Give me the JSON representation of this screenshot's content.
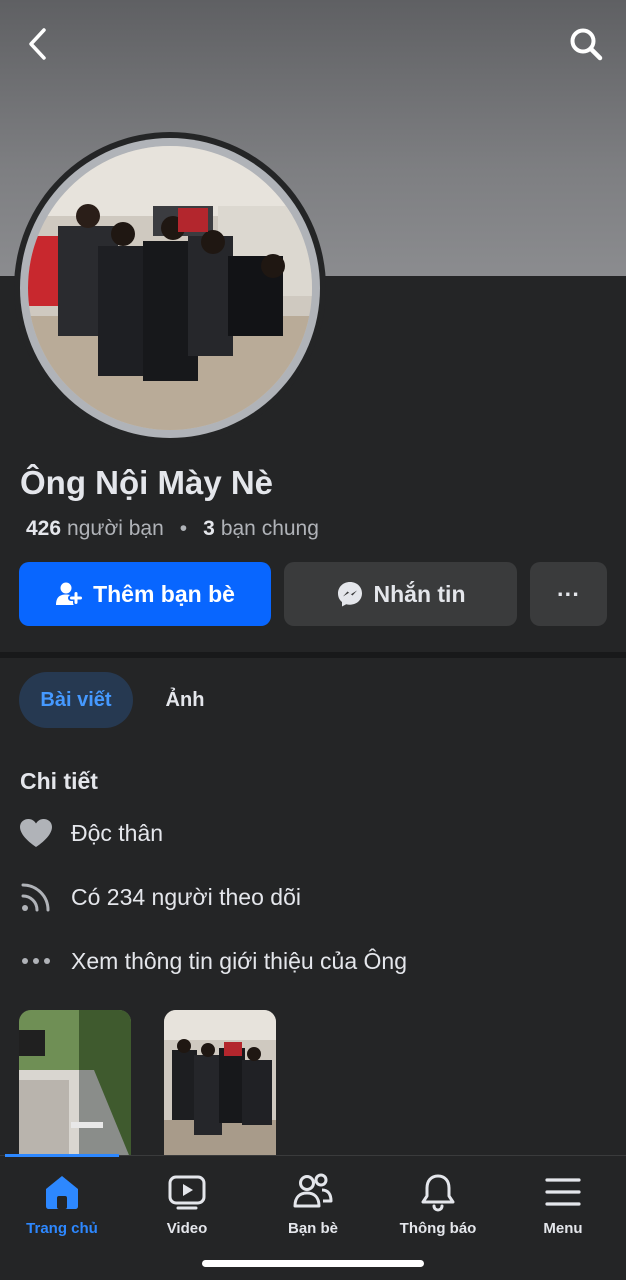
{
  "header": {
    "back_icon": "chevron-left-icon",
    "search_icon": "search-icon"
  },
  "profile": {
    "name": "Ông Nội Mày Nè",
    "friends_count": "426",
    "friends_label": "người bạn",
    "separator": "•",
    "mutual_count": "3",
    "mutual_label": "bạn chung"
  },
  "actions": {
    "add_friend_label": "Thêm bạn bè",
    "message_label": "Nhắn tin",
    "more_label": "···"
  },
  "tabs": [
    {
      "label": "Bài viết",
      "active": true
    },
    {
      "label": "Ảnh",
      "active": false
    }
  ],
  "details": {
    "title": "Chi tiết",
    "items": [
      {
        "icon": "heart-icon",
        "text": "Độc thân"
      },
      {
        "icon": "rss-icon",
        "text": "Có 234 người theo dõi"
      },
      {
        "icon": "more-dots-icon",
        "text": "Xem thông tin giới thiệu của Ông"
      }
    ]
  },
  "bottom_nav": [
    {
      "label": "Trang chủ",
      "icon": "home-icon",
      "active": true
    },
    {
      "label": "Video",
      "icon": "video-icon",
      "active": false
    },
    {
      "label": "Bạn bè",
      "icon": "friends-icon",
      "active": false
    },
    {
      "label": "Thông báo",
      "icon": "bell-icon",
      "active": false
    },
    {
      "label": "Menu",
      "icon": "menu-icon",
      "active": false
    }
  ],
  "colors": {
    "accent": "#0866ff",
    "active_nav": "#2d88ff",
    "background": "#242526",
    "button_dark": "#3a3b3c"
  }
}
